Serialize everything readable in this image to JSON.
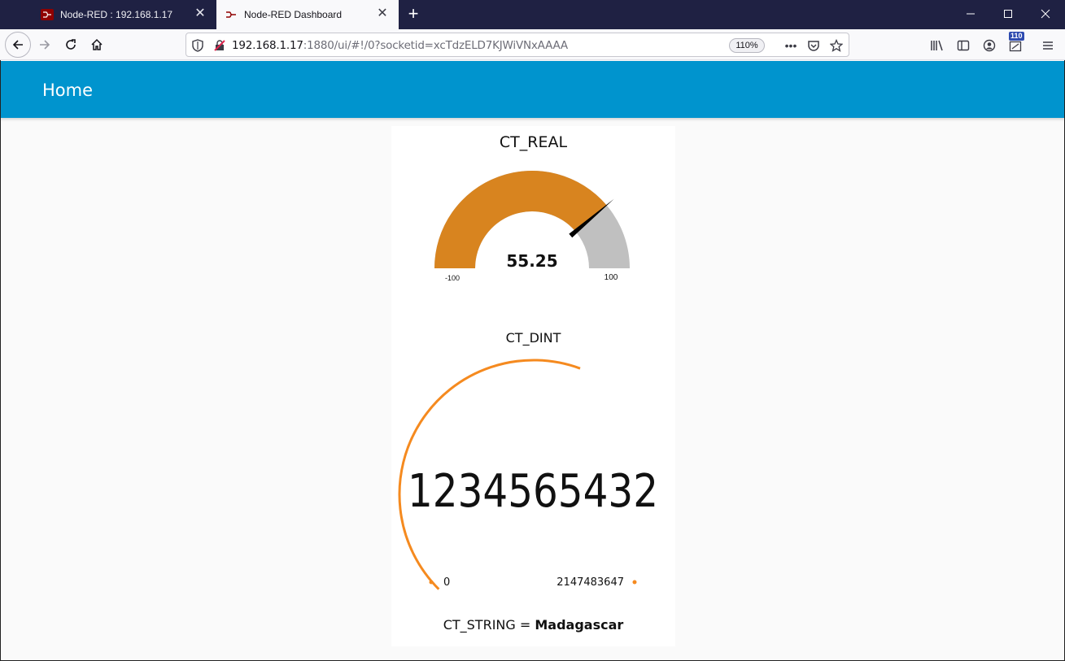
{
  "browser": {
    "tabs": [
      {
        "label": "Node-RED : 192.168.1.17",
        "active": false
      },
      {
        "label": "Node-RED Dashboard",
        "active": true
      }
    ],
    "url_host": "192.168.1.17",
    "url_rest": ":1880/ui/#!/0?socketid=xcTdzELD7KJWiVNxAAAA",
    "zoom": "110%",
    "badge_count": "110"
  },
  "dashboard": {
    "title": "Home",
    "gauge_real": {
      "label": "CT_REAL",
      "value": 55.25,
      "value_text": "55.25",
      "min": -100,
      "max": 100,
      "min_text": "-100",
      "max_text": "100",
      "fill_color": "#d8841f",
      "track_color": "#c0c0c0"
    },
    "gauge_dint": {
      "label": "CT_DINT",
      "value": 1234565432,
      "value_text": "1234565432",
      "min": 0,
      "max": 2147483647,
      "min_text": "0",
      "max_text": "2147483647",
      "color": "#f58a1f"
    },
    "text_string": {
      "label": "CT_STRING = ",
      "value": "Madagascar"
    }
  },
  "colors": {
    "header": "#0094ce",
    "titlebar": "#1f2143"
  }
}
